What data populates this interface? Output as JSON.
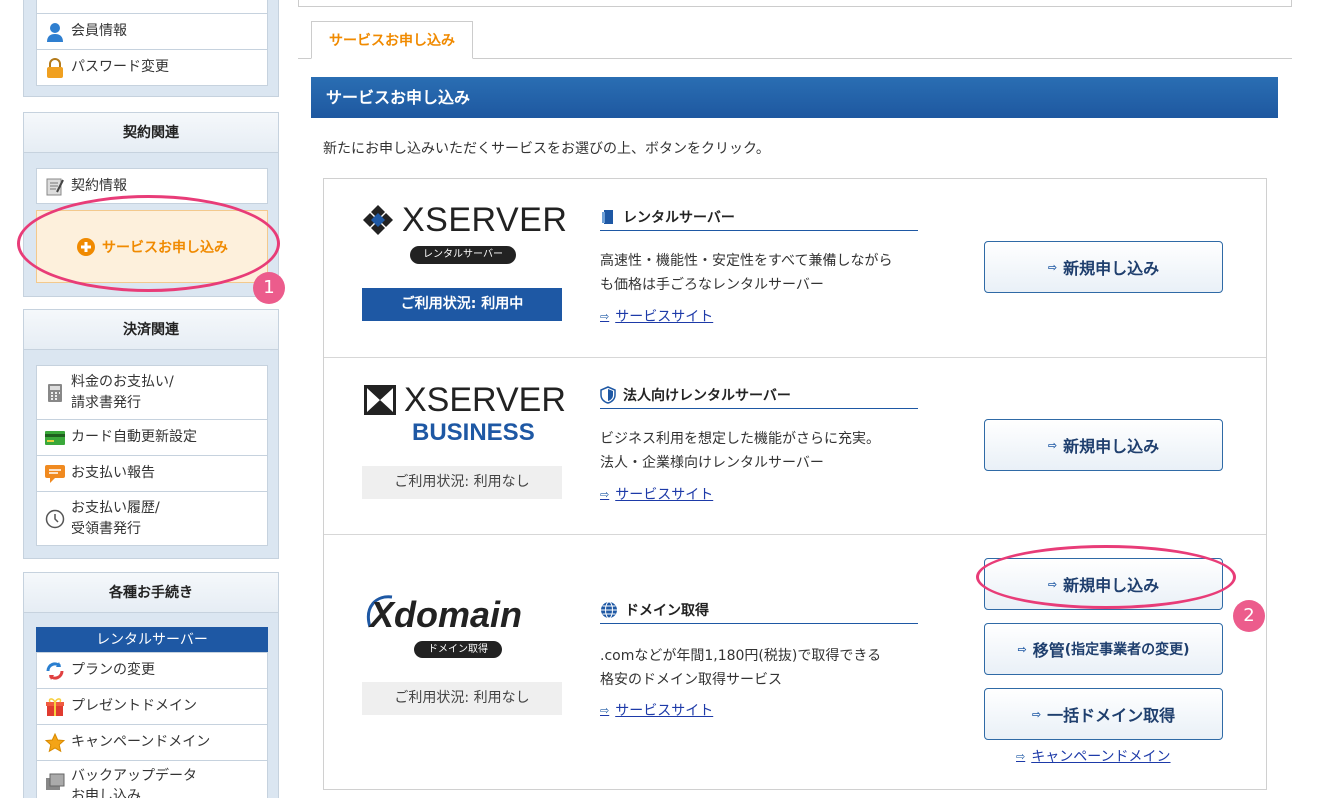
{
  "sidebar": {
    "account_items": [
      {
        "label": "会員情報",
        "icon": "member-icon"
      },
      {
        "label": "パスワード変更",
        "icon": "lock-icon"
      }
    ],
    "contract": {
      "title": "契約関連",
      "items": [
        {
          "label": "契約情報",
          "icon": "contract-icon"
        }
      ],
      "apply_label": "サービスお申し込み"
    },
    "payment": {
      "title": "決済関連",
      "items": [
        {
          "line1": "料金のお支払い/",
          "line2": "請求書発行",
          "icon": "calculator-icon"
        },
        {
          "label": "カード自動更新設定",
          "icon": "credit-card-icon"
        },
        {
          "label": "お支払い報告",
          "icon": "message-icon"
        },
        {
          "line1": "お支払い履歴/",
          "line2": "受領書発行",
          "icon": "clock-icon"
        }
      ]
    },
    "procedures": {
      "title": "各種お手続き",
      "subhead": "レンタルサーバー",
      "items": [
        {
          "label": "プランの変更",
          "icon": "refresh-icon"
        },
        {
          "label": "プレゼントドメイン",
          "icon": "gift-icon"
        },
        {
          "label": "キャンペーンドメイン",
          "icon": "star-icon"
        },
        {
          "label": "バックアップデータ",
          "label2": "お申し込み",
          "icon": "backup-icon"
        }
      ]
    }
  },
  "main": {
    "tab": "サービスお申し込み",
    "band_title": "サービスお申し込み",
    "intro": "新たにお申し込みいただくサービスをお選びの上、ボタンをクリック。",
    "services": [
      {
        "logo_text": "XSERVER",
        "logo_badge": "レンタルサーバー",
        "status": "ご利用状況: 利用中",
        "title": "レンタルサーバー",
        "desc1": "高速性・機能性・安定性をすべて兼備しながら",
        "desc2": "も価格は手ごろなレンタルサーバー",
        "site_link": "サービスサイト",
        "button": "新規申し込み"
      },
      {
        "logo_text": "XSERVER",
        "logo_sub": "BUSINESS",
        "status": "ご利用状況: 利用なし",
        "title": "法人向けレンタルサーバー",
        "desc1": "ビジネス利用を想定した機能がさらに充実。",
        "desc2": "法人・企業様向けレンタルサーバー",
        "site_link": "サービスサイト",
        "button": "新規申し込み"
      },
      {
        "logo_text": "Xdomain",
        "logo_badge": "ドメイン取得",
        "status": "ご利用状況: 利用なし",
        "title": "ドメイン取得",
        "desc1": ".comなどが年間1,180円(税抜)で取得できる",
        "desc2": "格安のドメイン取得サービス",
        "site_link": "サービスサイト",
        "button": "新規申し込み",
        "button_transfer": "移管",
        "button_transfer_sub": "(指定事業者の変更)",
        "button_bulk": "一括ドメイン取得",
        "campaign_link": "キャンペーンドメイン"
      }
    ]
  },
  "annotations": {
    "badge1": "1",
    "badge2": "2"
  },
  "colors": {
    "accent_blue": "#1e58a4",
    "orange": "#f08a00",
    "annotation_pink": "#e83c78"
  }
}
